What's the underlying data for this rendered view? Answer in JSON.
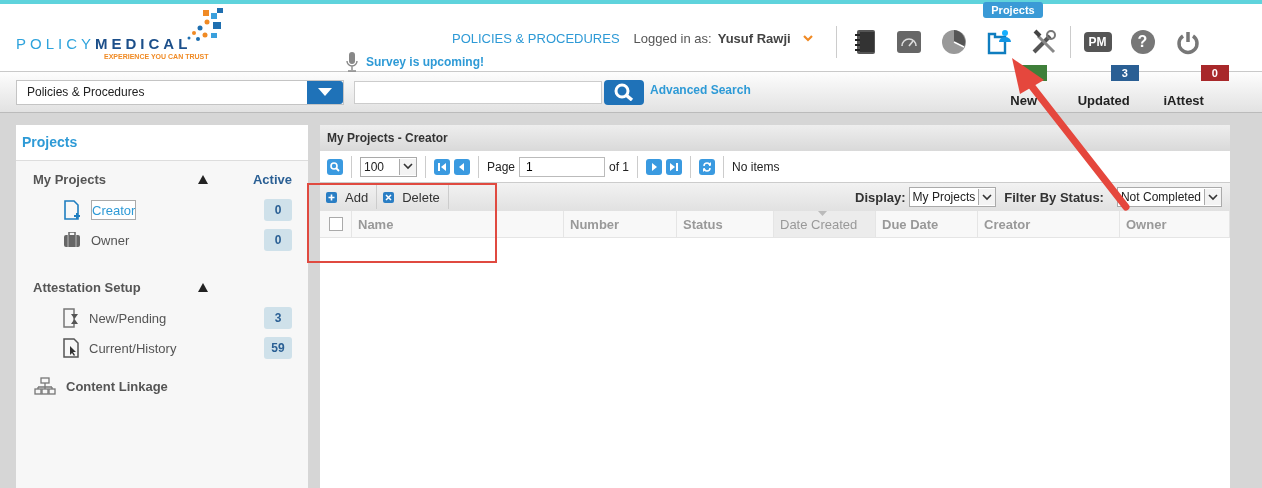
{
  "header": {
    "logo": {
      "first": "POLICY",
      "second": "MEDICAL",
      "tagline": "EXPERIENCE YOU CAN TRUST"
    },
    "module_title": "POLICIES & PROCEDURES",
    "login_label": "Logged in as:",
    "user": "Yusuf Rawji",
    "survey_notice": "Survey is upcoming!",
    "tooltip": "Projects",
    "toolbar_icons": [
      {
        "kind": "binder",
        "selected": false
      },
      {
        "kind": "dashboard",
        "selected": false
      },
      {
        "kind": "chart",
        "selected": false
      },
      {
        "kind": "projects",
        "selected": true
      },
      {
        "kind": "tools",
        "selected": false
      },
      {
        "kind": "pm",
        "label": "PM",
        "selected": false
      },
      {
        "kind": "help",
        "label": "?",
        "selected": false
      },
      {
        "kind": "power",
        "selected": false
      }
    ]
  },
  "search": {
    "scope": "Policies & Procedures",
    "advanced_link": "Advanced Search"
  },
  "counters": [
    {
      "label": "New",
      "color": "#3f7f3a"
    },
    {
      "label": "Updated",
      "count": "3",
      "color": "#2a5f94"
    },
    {
      "label": "iAttest",
      "count": "0",
      "color": "#a8282a"
    }
  ],
  "sidebar": {
    "title": "Projects",
    "sections": [
      {
        "kind": "group",
        "title": "My Projects",
        "expanded": true,
        "column_header": "Active",
        "items": [
          {
            "kind": "creator",
            "label": "Creator",
            "count": "0",
            "selected": true
          },
          {
            "kind": "owner",
            "label": "Owner",
            "count": "0",
            "selected": false
          }
        ]
      },
      {
        "kind": "group",
        "title": "Attestation Setup",
        "expanded": true,
        "items": [
          {
            "kind": "pending",
            "label": "New/Pending",
            "count": "3",
            "selected": false
          },
          {
            "kind": "history",
            "label": "Current/History",
            "count": "59",
            "selected": false
          }
        ]
      },
      {
        "kind": "link",
        "title": "Content Linkage"
      }
    ]
  },
  "panel": {
    "title": "My Projects - Creator",
    "pager": {
      "page_size": "100",
      "page_label": "Page",
      "page": "1",
      "of_label": "of 1",
      "status": "No items"
    },
    "actions": [
      {
        "kind": "add",
        "label": "Add"
      },
      {
        "kind": "delete",
        "label": "Delete"
      }
    ],
    "display_label": "Display:",
    "display_value": "My Projects",
    "filter_label": "Filter By Status:",
    "filter_value": "Not Completed",
    "select_all_checked": false,
    "columns": [
      {
        "label": "Name",
        "sorted": false
      },
      {
        "label": "Number",
        "sorted": false
      },
      {
        "label": "Status",
        "sorted": false
      },
      {
        "label": "Date Created",
        "sorted": true
      },
      {
        "label": "Due Date",
        "sorted": false
      },
      {
        "label": "Creator",
        "sorted": false
      },
      {
        "label": "Owner",
        "sorted": false
      }
    ]
  }
}
